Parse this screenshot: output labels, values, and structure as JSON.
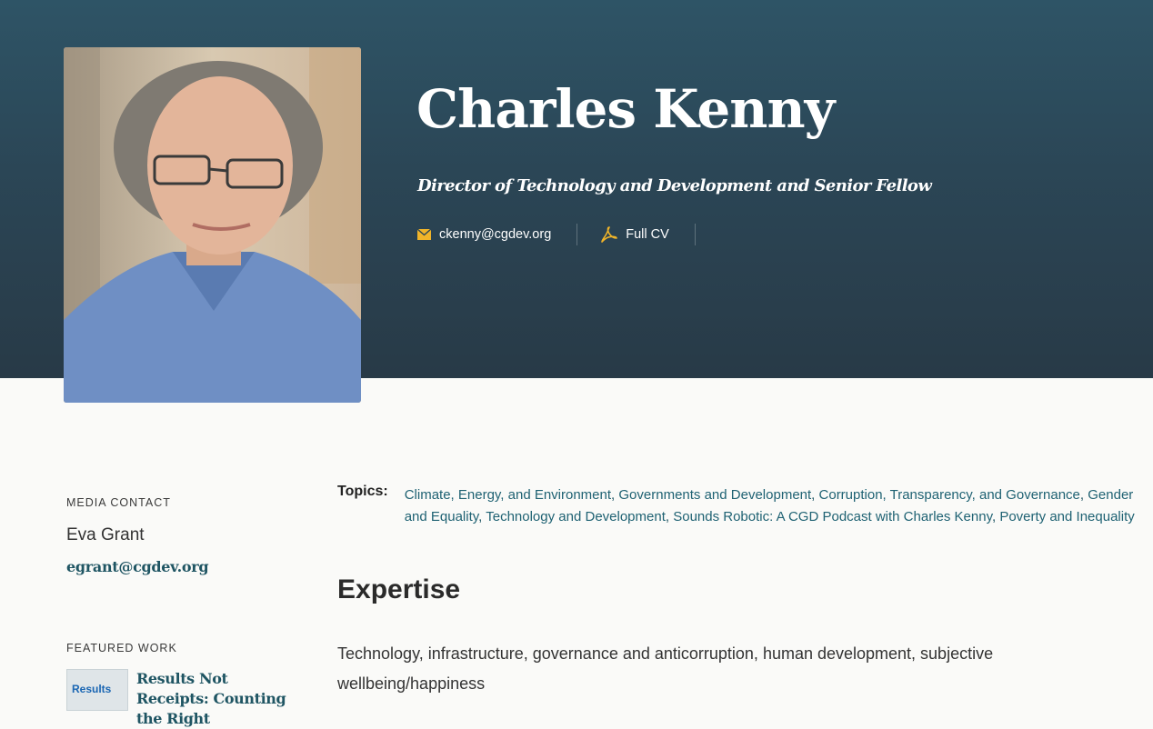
{
  "profile": {
    "name": "Charles Kenny",
    "title": "Director of Technology and Development and Senior Fellow",
    "email": "ckenny@cgdev.org",
    "cv_label": "Full CV"
  },
  "sidebar": {
    "media_contact_label": "MEDIA CONTACT",
    "media_contact_name": "Eva Grant",
    "media_contact_email": "egrant@cgdev.org",
    "featured_work_label": "FEATURED WORK",
    "featured_item_title": "Results Not Receipts: Counting the Right",
    "featured_item_thumb_text": "Results"
  },
  "topics": {
    "label": "Topics:",
    "items": [
      "Climate, Energy, and Environment",
      "Governments and Development",
      "Corruption, Transparency, and Governance",
      "Gender and Equality",
      "Technology and Development",
      "Sounds Robotic: A CGD Podcast with Charles Kenny",
      "Poverty and Inequality"
    ]
  },
  "expertise": {
    "heading": "Expertise",
    "body": "Technology, infrastructure, governance and anticorruption, human development, subjective wellbeing/happiness"
  },
  "colors": {
    "hero_top": "#2e5466",
    "hero_bottom": "#283a47",
    "link": "#1f6273",
    "icon_accent": "#f0b429"
  },
  "icons": {
    "email": "envelope-icon",
    "cv": "pdf-icon"
  }
}
